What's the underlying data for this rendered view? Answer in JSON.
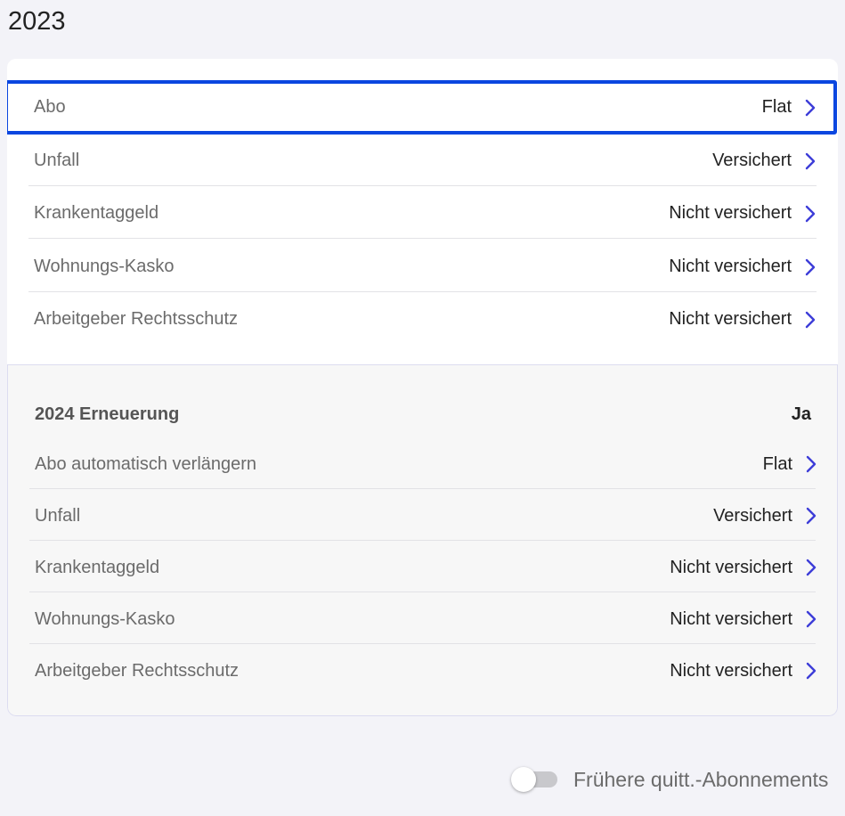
{
  "year": "2023",
  "current": {
    "rows": [
      {
        "label": "Abo",
        "value": "Flat"
      },
      {
        "label": "Unfall",
        "value": "Versichert"
      },
      {
        "label": "Krankentaggeld",
        "value": "Nicht versichert"
      },
      {
        "label": "Wohnungs-Kasko",
        "value": "Nicht versichert"
      },
      {
        "label": "Arbeitgeber Rechtsschutz",
        "value": "Nicht versichert"
      }
    ]
  },
  "renewal": {
    "title": "2024 Erneuerung",
    "status": "Ja",
    "rows": [
      {
        "label": "Abo automatisch verlängern",
        "value": "Flat"
      },
      {
        "label": "Unfall",
        "value": "Versichert"
      },
      {
        "label": "Krankentaggeld",
        "value": "Nicht versichert"
      },
      {
        "label": "Wohnungs-Kasko",
        "value": "Nicht versichert"
      },
      {
        "label": "Arbeitgeber Rechtsschutz",
        "value": "Nicht versichert"
      }
    ]
  },
  "toggle": {
    "label": "Frühere quitt.-Abonnements",
    "enabled": false
  },
  "colors": {
    "accent": "#3d3dd8",
    "highlight": "#0a46e0",
    "background": "#f3f3f8"
  },
  "icons": {
    "row_chevron": "chevron-right-icon"
  }
}
